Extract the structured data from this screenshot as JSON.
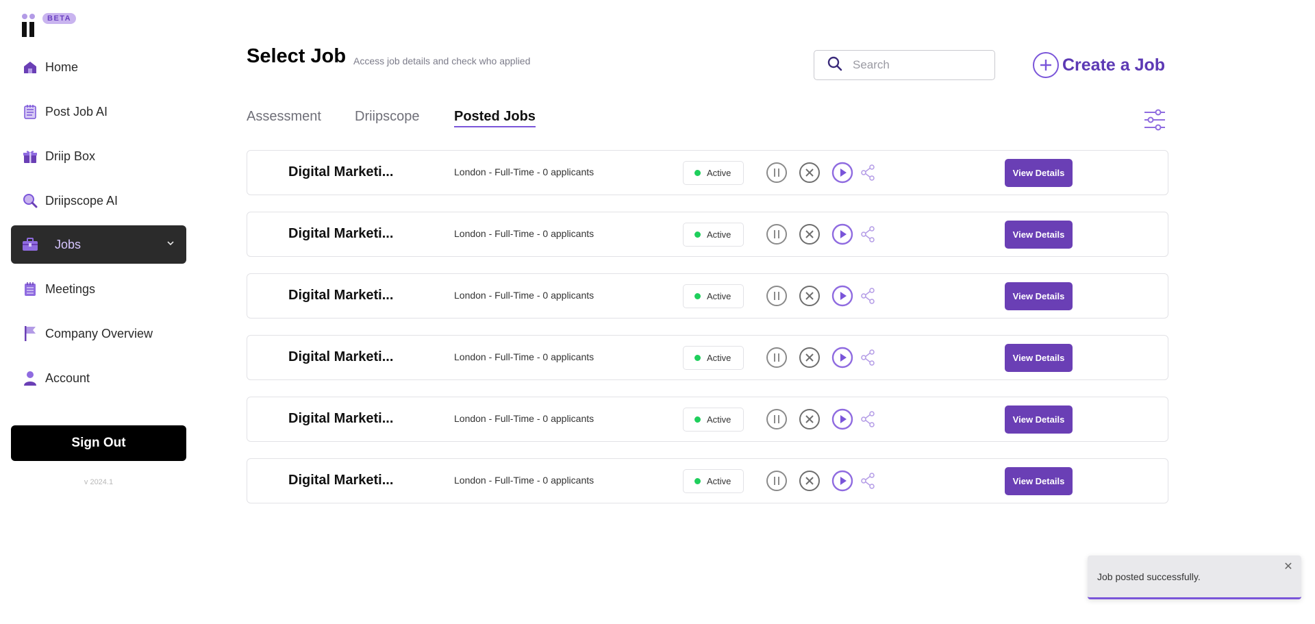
{
  "brand": {
    "badge": "BETA"
  },
  "sidebar": {
    "items": [
      {
        "label": "Home",
        "icon": "home-icon"
      },
      {
        "label": "Post Job AI",
        "icon": "notepad-icon"
      },
      {
        "label": "Driip Box",
        "icon": "gift-box-icon"
      },
      {
        "label": "Driipscope AI",
        "icon": "magnifier-icon"
      },
      {
        "label": "Jobs",
        "icon": "briefcase-icon",
        "active": true
      },
      {
        "label": "Meetings",
        "icon": "calendar-icon"
      },
      {
        "label": "Company Overview",
        "icon": "flag-icon"
      },
      {
        "label": "Account",
        "icon": "user-icon"
      }
    ],
    "signout_label": "Sign Out",
    "version": "v 2024.1"
  },
  "header": {
    "title": "Select Job",
    "subtitle": "Access job details and check who applied",
    "search_placeholder": "Search",
    "create_label": "Create a Job"
  },
  "tabs": [
    {
      "label": "Assessment"
    },
    {
      "label": "Driipscope"
    },
    {
      "label": "Posted Jobs",
      "active": true
    }
  ],
  "jobs": [
    {
      "title": "Digital Marketi...",
      "meta": "London - Full-Time - 0 applicants",
      "status": "Active",
      "action_label": "View Details"
    },
    {
      "title": "Digital Marketi...",
      "meta": "London - Full-Time - 0 applicants",
      "status": "Active",
      "action_label": "View Details"
    },
    {
      "title": "Digital Marketi...",
      "meta": "London - Full-Time - 0 applicants",
      "status": "Active",
      "action_label": "View Details"
    },
    {
      "title": "Digital Marketi...",
      "meta": "London - Full-Time - 0 applicants",
      "status": "Active",
      "action_label": "View Details"
    },
    {
      "title": "Digital Marketi...",
      "meta": "London - Full-Time - 0 applicants",
      "status": "Active",
      "action_label": "View Details"
    },
    {
      "title": "Digital Marketi...",
      "meta": "London - Full-Time - 0 applicants",
      "status": "Active",
      "action_label": "View Details"
    }
  ],
  "toast": {
    "message": "Job posted successfully.",
    "close": "✕"
  },
  "colors": {
    "accent": "#6a3fb5",
    "accent_light": "#7a55d9",
    "active_nav_bg": "#2b2b2b",
    "status_green": "#1fcf5c"
  }
}
